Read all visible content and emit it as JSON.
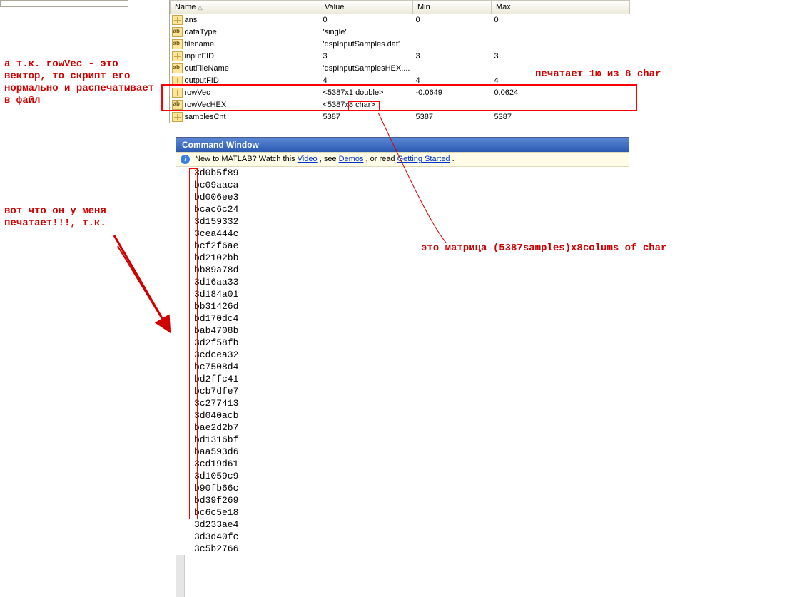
{
  "workspace": {
    "headers": {
      "name": "Name",
      "value": "Value",
      "min": "Min",
      "max": "Max"
    },
    "rows": [
      {
        "icon": "num",
        "name": "ans",
        "value": "0",
        "min": "0",
        "max": "0"
      },
      {
        "icon": "str",
        "name": "dataType",
        "value": "'single'",
        "min": "",
        "max": ""
      },
      {
        "icon": "str",
        "name": "filename",
        "value": "'dspInputSamples.dat'",
        "min": "",
        "max": ""
      },
      {
        "icon": "num",
        "name": "inputFID",
        "value": "3",
        "min": "3",
        "max": "3"
      },
      {
        "icon": "str",
        "name": "outFileName",
        "value": "'dspInputSamplesHEX....",
        "min": "",
        "max": ""
      },
      {
        "icon": "num",
        "name": "outputFID",
        "value": "4",
        "min": "4",
        "max": "4"
      },
      {
        "icon": "num",
        "name": "rowVec",
        "value": "<5387x1 double>",
        "min": "-0.0649",
        "max": "0.0624"
      },
      {
        "icon": "str",
        "name": "rowVecHEX",
        "value": "<5387x8 char>",
        "min": "",
        "max": ""
      },
      {
        "icon": "num",
        "name": "samplesCnt",
        "value": "5387",
        "min": "5387",
        "max": "5387"
      }
    ]
  },
  "command_window": {
    "title": "Command Window",
    "info_prefix": "New to MATLAB? Watch this ",
    "link_video": "Video",
    "info_mid1": ", see ",
    "link_demos": "Demos",
    "info_mid2": ", or read ",
    "link_gs": "Getting Started",
    "info_suffix": ".",
    "output": [
      "3d0b5f89",
      "bc09aaca",
      "bd006ee3",
      "bcac6c24",
      "3d159332",
      "3cea444c",
      "bcf2f6ae",
      "bd2102bb",
      "bb89a78d",
      "3d16aa33",
      "3d184a01",
      "bb31426d",
      "bd170dc4",
      "bab4708b",
      "3d2f58fb",
      "3cdcea32",
      "bc7508d4",
      "bd2ffc41",
      "bcb7dfe7",
      "3c277413",
      "3d040acb",
      "bae2d2b7",
      "bd1316bf",
      "baa593d6",
      "3cd19d61",
      "3d1059c9",
      "b90fb66c",
      "bd39f269",
      "bc6c5e18",
      "3d233ae4",
      "3d3d40fc",
      "3c5b2766"
    ]
  },
  "annotations": {
    "top_left": "а т.к. rowVec - это\nвектор, то скрипт его\nнормально и распечатывает\nв файл",
    "top_right": "печатает 1ю из 8 char",
    "mid_left": "вот что он у меня\nпечатает!!!, т.к.",
    "mid_right": "это матрица (5387samples)x8colums of char"
  }
}
